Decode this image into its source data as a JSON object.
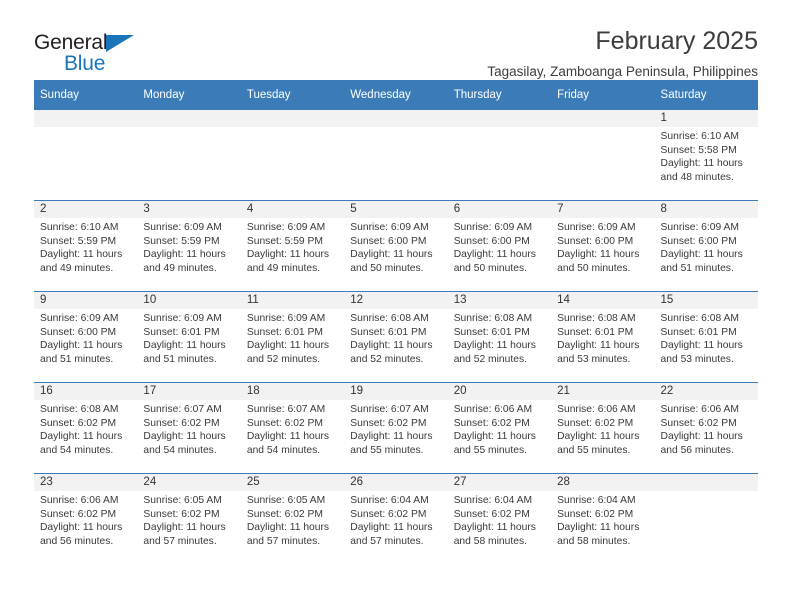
{
  "brand": {
    "name_top": "General",
    "name_bottom": "Blue",
    "accent_color": "#1b75bb"
  },
  "header": {
    "title": "February 2025",
    "subtitle": "Tagasilay, Zamboanga Peninsula, Philippines"
  },
  "theme": {
    "header_row_color": "#3b7cb8",
    "daynum_band_color": "#f2f2f2",
    "text_color": "#3a3a3a"
  },
  "weekday_headers": [
    "Sunday",
    "Monday",
    "Tuesday",
    "Wednesday",
    "Thursday",
    "Friday",
    "Saturday"
  ],
  "weeks": [
    [
      {
        "day": "",
        "blank": true,
        "sunrise": "",
        "sunset": "",
        "daylight": ""
      },
      {
        "day": "",
        "blank": true,
        "sunrise": "",
        "sunset": "",
        "daylight": ""
      },
      {
        "day": "",
        "blank": true,
        "sunrise": "",
        "sunset": "",
        "daylight": ""
      },
      {
        "day": "",
        "blank": true,
        "sunrise": "",
        "sunset": "",
        "daylight": ""
      },
      {
        "day": "",
        "blank": true,
        "sunrise": "",
        "sunset": "",
        "daylight": ""
      },
      {
        "day": "",
        "blank": true,
        "sunrise": "",
        "sunset": "",
        "daylight": ""
      },
      {
        "day": "1",
        "blank": false,
        "sunrise": "Sunrise: 6:10 AM",
        "sunset": "Sunset: 5:58 PM",
        "daylight": "Daylight: 11 hours and 48 minutes."
      }
    ],
    [
      {
        "day": "2",
        "blank": false,
        "sunrise": "Sunrise: 6:10 AM",
        "sunset": "Sunset: 5:59 PM",
        "daylight": "Daylight: 11 hours and 49 minutes."
      },
      {
        "day": "3",
        "blank": false,
        "sunrise": "Sunrise: 6:09 AM",
        "sunset": "Sunset: 5:59 PM",
        "daylight": "Daylight: 11 hours and 49 minutes."
      },
      {
        "day": "4",
        "blank": false,
        "sunrise": "Sunrise: 6:09 AM",
        "sunset": "Sunset: 5:59 PM",
        "daylight": "Daylight: 11 hours and 49 minutes."
      },
      {
        "day": "5",
        "blank": false,
        "sunrise": "Sunrise: 6:09 AM",
        "sunset": "Sunset: 6:00 PM",
        "daylight": "Daylight: 11 hours and 50 minutes."
      },
      {
        "day": "6",
        "blank": false,
        "sunrise": "Sunrise: 6:09 AM",
        "sunset": "Sunset: 6:00 PM",
        "daylight": "Daylight: 11 hours and 50 minutes."
      },
      {
        "day": "7",
        "blank": false,
        "sunrise": "Sunrise: 6:09 AM",
        "sunset": "Sunset: 6:00 PM",
        "daylight": "Daylight: 11 hours and 50 minutes."
      },
      {
        "day": "8",
        "blank": false,
        "sunrise": "Sunrise: 6:09 AM",
        "sunset": "Sunset: 6:00 PM",
        "daylight": "Daylight: 11 hours and 51 minutes."
      }
    ],
    [
      {
        "day": "9",
        "blank": false,
        "sunrise": "Sunrise: 6:09 AM",
        "sunset": "Sunset: 6:00 PM",
        "daylight": "Daylight: 11 hours and 51 minutes."
      },
      {
        "day": "10",
        "blank": false,
        "sunrise": "Sunrise: 6:09 AM",
        "sunset": "Sunset: 6:01 PM",
        "daylight": "Daylight: 11 hours and 51 minutes."
      },
      {
        "day": "11",
        "blank": false,
        "sunrise": "Sunrise: 6:09 AM",
        "sunset": "Sunset: 6:01 PM",
        "daylight": "Daylight: 11 hours and 52 minutes."
      },
      {
        "day": "12",
        "blank": false,
        "sunrise": "Sunrise: 6:08 AM",
        "sunset": "Sunset: 6:01 PM",
        "daylight": "Daylight: 11 hours and 52 minutes."
      },
      {
        "day": "13",
        "blank": false,
        "sunrise": "Sunrise: 6:08 AM",
        "sunset": "Sunset: 6:01 PM",
        "daylight": "Daylight: 11 hours and 52 minutes."
      },
      {
        "day": "14",
        "blank": false,
        "sunrise": "Sunrise: 6:08 AM",
        "sunset": "Sunset: 6:01 PM",
        "daylight": "Daylight: 11 hours and 53 minutes."
      },
      {
        "day": "15",
        "blank": false,
        "sunrise": "Sunrise: 6:08 AM",
        "sunset": "Sunset: 6:01 PM",
        "daylight": "Daylight: 11 hours and 53 minutes."
      }
    ],
    [
      {
        "day": "16",
        "blank": false,
        "sunrise": "Sunrise: 6:08 AM",
        "sunset": "Sunset: 6:02 PM",
        "daylight": "Daylight: 11 hours and 54 minutes."
      },
      {
        "day": "17",
        "blank": false,
        "sunrise": "Sunrise: 6:07 AM",
        "sunset": "Sunset: 6:02 PM",
        "daylight": "Daylight: 11 hours and 54 minutes."
      },
      {
        "day": "18",
        "blank": false,
        "sunrise": "Sunrise: 6:07 AM",
        "sunset": "Sunset: 6:02 PM",
        "daylight": "Daylight: 11 hours and 54 minutes."
      },
      {
        "day": "19",
        "blank": false,
        "sunrise": "Sunrise: 6:07 AM",
        "sunset": "Sunset: 6:02 PM",
        "daylight": "Daylight: 11 hours and 55 minutes."
      },
      {
        "day": "20",
        "blank": false,
        "sunrise": "Sunrise: 6:06 AM",
        "sunset": "Sunset: 6:02 PM",
        "daylight": "Daylight: 11 hours and 55 minutes."
      },
      {
        "day": "21",
        "blank": false,
        "sunrise": "Sunrise: 6:06 AM",
        "sunset": "Sunset: 6:02 PM",
        "daylight": "Daylight: 11 hours and 55 minutes."
      },
      {
        "day": "22",
        "blank": false,
        "sunrise": "Sunrise: 6:06 AM",
        "sunset": "Sunset: 6:02 PM",
        "daylight": "Daylight: 11 hours and 56 minutes."
      }
    ],
    [
      {
        "day": "23",
        "blank": false,
        "sunrise": "Sunrise: 6:06 AM",
        "sunset": "Sunset: 6:02 PM",
        "daylight": "Daylight: 11 hours and 56 minutes."
      },
      {
        "day": "24",
        "blank": false,
        "sunrise": "Sunrise: 6:05 AM",
        "sunset": "Sunset: 6:02 PM",
        "daylight": "Daylight: 11 hours and 57 minutes."
      },
      {
        "day": "25",
        "blank": false,
        "sunrise": "Sunrise: 6:05 AM",
        "sunset": "Sunset: 6:02 PM",
        "daylight": "Daylight: 11 hours and 57 minutes."
      },
      {
        "day": "26",
        "blank": false,
        "sunrise": "Sunrise: 6:04 AM",
        "sunset": "Sunset: 6:02 PM",
        "daylight": "Daylight: 11 hours and 57 minutes."
      },
      {
        "day": "27",
        "blank": false,
        "sunrise": "Sunrise: 6:04 AM",
        "sunset": "Sunset: 6:02 PM",
        "daylight": "Daylight: 11 hours and 58 minutes."
      },
      {
        "day": "28",
        "blank": false,
        "sunrise": "Sunrise: 6:04 AM",
        "sunset": "Sunset: 6:02 PM",
        "daylight": "Daylight: 11 hours and 58 minutes."
      },
      {
        "day": "",
        "blank": true,
        "sunrise": "",
        "sunset": "",
        "daylight": ""
      }
    ]
  ]
}
